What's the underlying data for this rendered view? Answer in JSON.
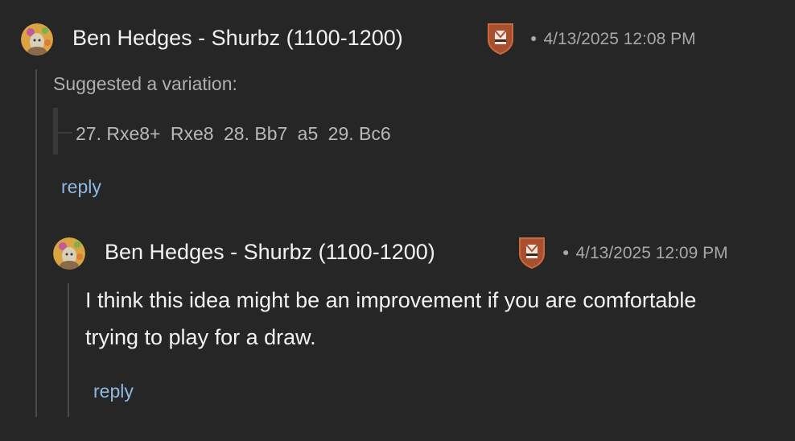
{
  "comments": [
    {
      "author": "Ben Hedges - Shurbz (1100-1200)",
      "avatar_icon": "user-avatar-icon",
      "badge_icon": "coach-badge-icon",
      "timestamp": "4/13/2025 12:08 PM",
      "label": "Suggested a variation:",
      "variation": {
        "m1": "27. Rxe8+",
        "m2": "Rxe8",
        "m3": "28. Bb7",
        "m4": "a5",
        "m5": "29. Bc6"
      },
      "reply_label": "reply"
    },
    {
      "author": "Ben Hedges - Shurbz (1100-1200)",
      "avatar_icon": "user-avatar-icon",
      "badge_icon": "coach-badge-icon",
      "timestamp": "4/13/2025 12:09 PM",
      "text": "I think this idea might be an improvement if you are comfortable trying to play for a draw.",
      "reply_label": "reply"
    }
  ],
  "colors": {
    "background": "#262626",
    "link": "#8fb8e3",
    "badge": "#a8502e"
  }
}
